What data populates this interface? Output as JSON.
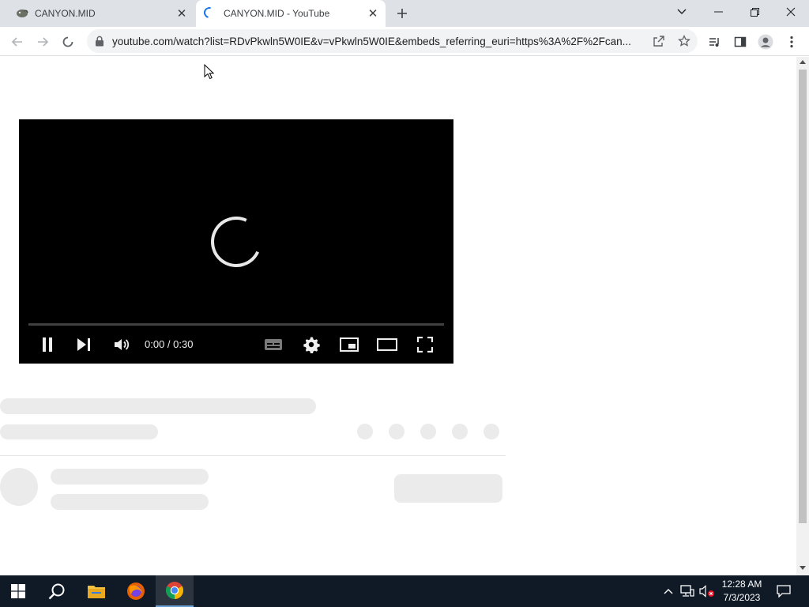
{
  "browser": {
    "tabs": [
      {
        "title": "CANYON.MID",
        "favicon": "chameleon-icon",
        "active": false
      },
      {
        "title": "CANYON.MID - YouTube",
        "favicon": "loading-spinner-icon",
        "active": true
      }
    ],
    "new_tab_icon": "plus-icon",
    "window_controls": [
      "chevron-down-icon",
      "minimize-icon",
      "restore-icon",
      "close-icon"
    ],
    "toolbar": {
      "back_icon": "arrow-left-icon",
      "forward_icon": "arrow-right-icon",
      "stop_icon": "loading-icon",
      "url": "youtube.com/watch?list=RDvPkwln5W0IE&v=vPkwln5W0IE&embeds_referring_euri=https%3A%2F%2Fcan...",
      "share_icon": "share-icon",
      "bookmark_icon": "star-icon",
      "right_icons": [
        "media-queue-icon",
        "side-panel-icon",
        "profile-icon",
        "more-vert-icon"
      ]
    },
    "accent_color": "#1a73e8"
  },
  "player": {
    "state": "loading",
    "time_display": "0:00 / 0:30",
    "progress": 0,
    "controls": [
      "pause-icon",
      "next-icon",
      "volume-icon",
      "subtitles-icon",
      "settings-icon",
      "miniplayer-icon",
      "theater-icon",
      "fullscreen-icon"
    ]
  },
  "skeleton": {
    "placeholder_color": "#ebebeb"
  },
  "taskbar": {
    "items": [
      "windows-start-icon",
      "search-icon",
      "file-explorer-icon",
      "firefox-icon",
      "chrome-icon"
    ],
    "active_item": "chrome-icon",
    "tray_icons": [
      "chevron-up-icon",
      "network-icon",
      "volume-muted-icon",
      "notification-icon"
    ],
    "time": "12:28 AM",
    "date": "7/3/2023"
  }
}
